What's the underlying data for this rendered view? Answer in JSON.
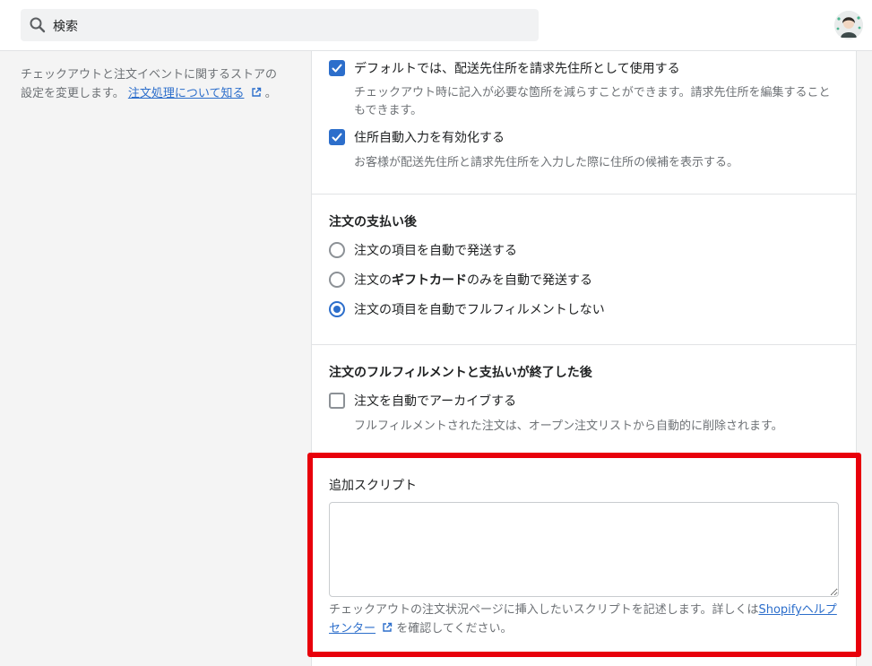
{
  "header": {
    "search_placeholder": "検索",
    "search_icon": "search-icon",
    "avatar_icon": "avatar"
  },
  "sidebar": {
    "description": "チェックアウトと注文イベントに関するストアの設定を変更します。",
    "link_text": "注文処理について知る",
    "after_link": "。"
  },
  "address": {
    "billing_default": {
      "label": "デフォルトでは、配送先住所を請求先住所として使用する",
      "checked": true,
      "help": "チェックアウト時に記入が必要な箇所を減らすことができます。請求先住所を編集することもできます。"
    },
    "autocomplete": {
      "label": "住所自動入力を有効化する",
      "checked": true,
      "help": "お客様が配送先住所と請求先住所を入力した際に住所の候補を表示する。"
    }
  },
  "after_payment": {
    "title": "注文の支払い後",
    "opt1": "注文の項目を自動で発送する",
    "opt2_pre": "注文の",
    "opt2_bold": "ギフトカード",
    "opt2_post": "のみを自動で発送する",
    "opt3": "注文の項目を自動でフルフィルメントしない",
    "selected_option": 3
  },
  "after_fulfillment": {
    "title": "注文のフルフィルメントと支払いが終了した後",
    "archive_label": "注文を自動でアーカイブする",
    "archive_checked": false,
    "help": "フルフィルメントされた注文は、オープン注文リストから自動的に削除されます。"
  },
  "additional_scripts": {
    "label": "追加スクリプト",
    "value": "",
    "help_pre": "チェックアウトの注文状況ページに挿入したいスクリプトを記述します。詳しくは",
    "help_link": "Shopifyヘルプセンター",
    "help_post": "を確認してください。"
  },
  "colors": {
    "accent": "#2c6ecb",
    "highlight": "#e8000b"
  }
}
